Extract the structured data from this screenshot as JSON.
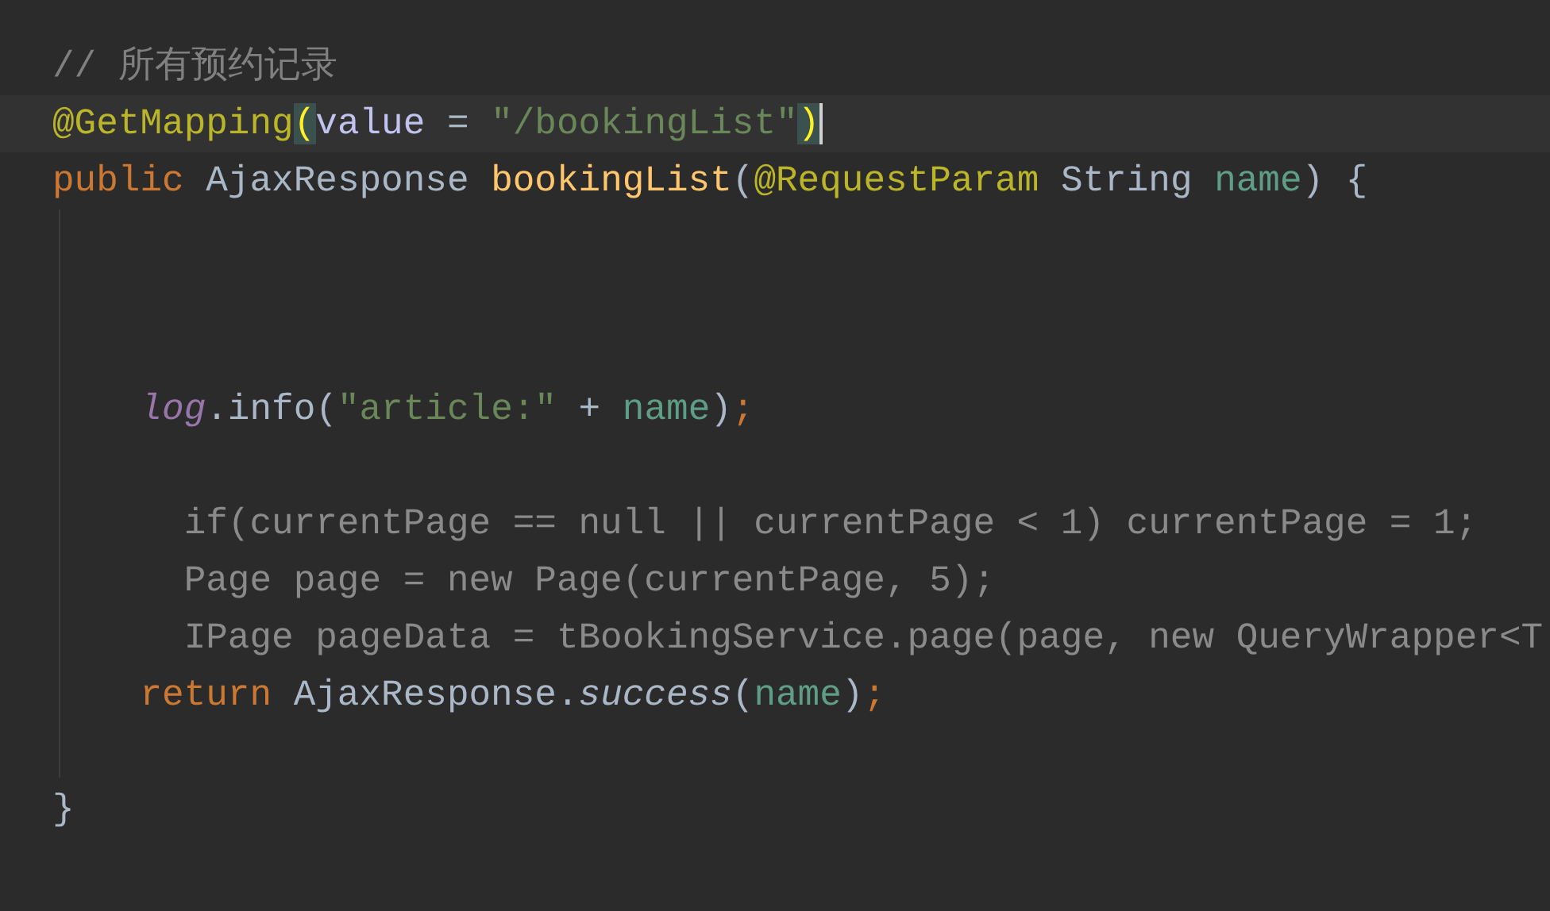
{
  "editor": {
    "lines": [
      {
        "current": false,
        "tokens": [
          {
            "kind": "comment",
            "text": "// 所有预约记录"
          }
        ]
      },
      {
        "current": true,
        "tokens": [
          {
            "kind": "annotation",
            "text": "@GetMapping"
          },
          {
            "kind": "bracket-match",
            "text": "("
          },
          {
            "kind": "attr",
            "text": "value"
          },
          {
            "kind": "plain",
            "text": " = "
          },
          {
            "kind": "string",
            "text": "\"/bookingList\""
          },
          {
            "kind": "bracket-match",
            "text": ")"
          }
        ]
      },
      {
        "current": false,
        "tokens": [
          {
            "kind": "keyword",
            "text": "public "
          },
          {
            "kind": "plain",
            "text": "AjaxResponse "
          },
          {
            "kind": "method",
            "text": "bookingList"
          },
          {
            "kind": "plain",
            "text": "("
          },
          {
            "kind": "annotation",
            "text": "@RequestParam "
          },
          {
            "kind": "plain",
            "text": "String "
          },
          {
            "kind": "param",
            "text": "name"
          },
          {
            "kind": "plain",
            "text": ") {"
          }
        ]
      },
      {
        "current": false
      },
      {
        "current": false
      },
      {
        "current": false
      },
      {
        "current": false,
        "tokens": [
          {
            "kind": "field",
            "text": "    log"
          },
          {
            "kind": "plain",
            "text": ".info("
          },
          {
            "kind": "string",
            "text": "\"article:\""
          },
          {
            "kind": "plain",
            "text": " + "
          },
          {
            "kind": "param",
            "text": "name"
          },
          {
            "kind": "plain",
            "text": ")"
          },
          {
            "kind": "keyword",
            "text": ";"
          }
        ]
      },
      {
        "current": false
      },
      {
        "current": false,
        "tokens": [
          {
            "kind": "disabled",
            "text": "      if(currentPage == null || currentPage < 1) currentPage = 1;"
          }
        ]
      },
      {
        "current": false,
        "tokens": [
          {
            "kind": "disabled",
            "text": "      Page page = new Page(currentPage, 5);"
          }
        ]
      },
      {
        "current": false,
        "tokens": [
          {
            "kind": "disabled",
            "text": "      IPage pageData = tBookingService.page(page, new QueryWrapper<T"
          }
        ]
      },
      {
        "current": false,
        "tokens": [
          {
            "kind": "keyword",
            "text": "    return "
          },
          {
            "kind": "plain",
            "text": "AjaxResponse."
          },
          {
            "kind": "static",
            "text": "success"
          },
          {
            "kind": "plain",
            "text": "("
          },
          {
            "kind": "param",
            "text": "name"
          },
          {
            "kind": "plain",
            "text": ")"
          },
          {
            "kind": "keyword",
            "text": ";"
          }
        ]
      },
      {
        "current": false
      },
      {
        "current": false,
        "tokens": [
          {
            "kind": "plain",
            "text": "}"
          }
        ]
      }
    ]
  }
}
